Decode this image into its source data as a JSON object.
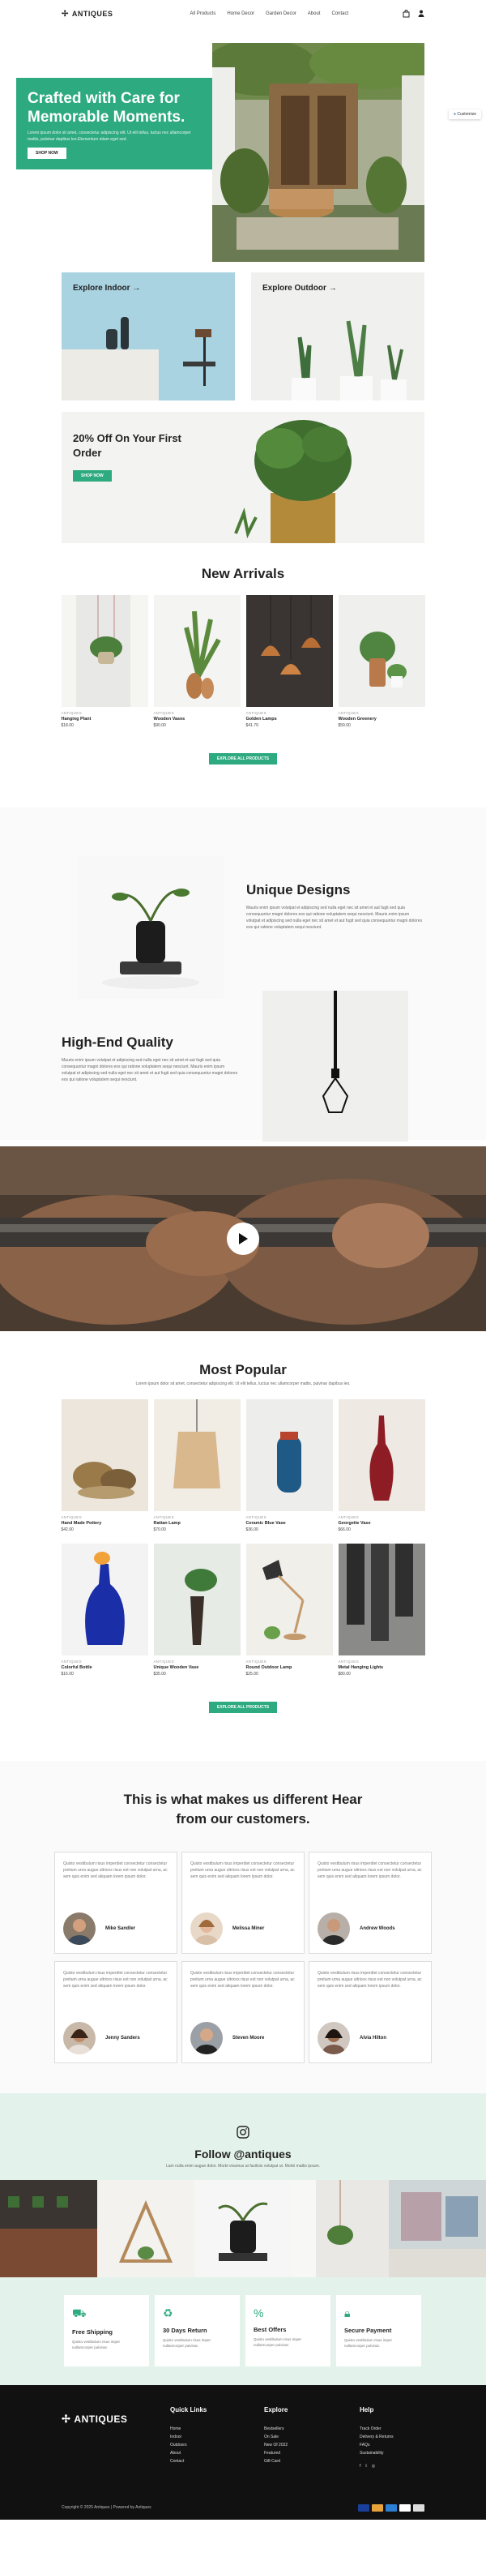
{
  "header": {
    "logo": "ANTIQUES",
    "nav": [
      "All Products",
      "Home Decor",
      "Garden Decor",
      "About",
      "Contact"
    ]
  },
  "hero": {
    "title": "Crafted with Care for Memorable Moments.",
    "text": "Lorem ipsum dolor sit amet, consectetur adipiscing elit. Ut elit tellus, luctus nec ullamcorper mattis, pulvinar dapibus leo.Elementum etiam eget sed.",
    "button": "SHOP NOW",
    "customize": "Customize"
  },
  "categories": {
    "indoor": "Explore Indoor",
    "outdoor": "Explore Outdoor",
    "promo_title": "20% Off On Your First Order",
    "promo_button": "SHOP NOW"
  },
  "new_arrivals": {
    "title": "New Arrivals",
    "products": [
      {
        "category": "ANTIQUES",
        "name": "Hanging Plant",
        "price": "$18.00"
      },
      {
        "category": "ANTIQUES",
        "name": "Wooden Vases",
        "price": "$90.00"
      },
      {
        "category": "ANTIQUES",
        "name": "Golden Lamps",
        "price": "$41.79"
      },
      {
        "category": "ANTIQUES",
        "name": "Wooden Greenery",
        "price": "$59.00"
      }
    ],
    "button": "EXPLORE ALL PRODUCTS"
  },
  "about": {
    "unique_title": "Unique Designs",
    "unique_text": "Mauris enim ipsum volutpat et adipiscing sed nulla eget nec sit amet et aut fugit sed quia consequuntur magni dolores eos qui ratione voluptatem sequi nesciunt. Mauris enim ipsum volutpat et adipiscing sed nulla eget nec sit amet et aut fugit sed quia consequuntur magni dolores eos qui ratione voluptatem sequi nesciunt.",
    "quality_title": "High-End Quality",
    "quality_text": "Mauris enim ipsum volutpat et adipiscing sed nulla eget nec sit amet et aut fugit sed quia consequuntur magni dolores eos qui ratione voluptatem sequi nesciunt. Mauris enim ipsum volutpat et adipiscing sed nulla eget nec sit amet et aut fugit sed quia consequuntur magni dolores eos qui ratione voluptatem sequi nesciunt."
  },
  "popular": {
    "title": "Most Popular",
    "subtitle": "Lorem ipsum dolor sit amet, consectetur adipiscing elit. Ut elit tellus, luctus nec ullamcorper mattis, pulvinar dapibus leo.",
    "products": [
      {
        "category": "ANTIQUES",
        "name": "Hand Made Pottery",
        "price": "$42.00"
      },
      {
        "category": "ANTIQUES",
        "name": "Rattan Lamp",
        "price": "$70.00"
      },
      {
        "category": "ANTIQUES",
        "name": "Ceramic Blue Vase",
        "price": "$36.00"
      },
      {
        "category": "ANTIQUES",
        "name": "Georgette Vase",
        "price": "$66.00"
      },
      {
        "category": "ANTIQUES",
        "name": "Colorful Bottle",
        "price": "$16.00"
      },
      {
        "category": "ANTIQUES",
        "name": "Unique Wooden Vase",
        "price": "$35.00"
      },
      {
        "category": "ANTIQUES",
        "name": "Round Outdoor Lamp",
        "price": "$25.00"
      },
      {
        "category": "ANTIQUES",
        "name": "Metal Hanging Lights",
        "price": "$80.00"
      }
    ],
    "button": "EXPLORE ALL PRODUCTS"
  },
  "testimonials": {
    "title": "This is what makes us different Hear from our customers.",
    "quote": "Quisto vestibulum risus imperdiet consectetur consectetur pretium urna augue ultrices risus est non volutpat urna, ac sem quis enim sed aliquam lorem ipsum dolor.",
    "people": [
      "Mike Sandler",
      "Melissa Miner",
      "Andrew Woods",
      "Jenny Sanders",
      "Steven Moore",
      "Alvia Hilton"
    ]
  },
  "instagram": {
    "title": "Follow @antiques",
    "subtitle": "Lam nulla enim augue dolor. Morbi vivamus at facilisis volutpat ut. Morbi mattis ipsum."
  },
  "features": [
    {
      "icon": "truck-icon",
      "title": "Free Shipping",
      "text": "Quisto vestibulum risus imper nullamcorper pulvinar."
    },
    {
      "icon": "recycle-icon",
      "title": "30 Days Return",
      "text": "Quisto vestibulum risus imper nullamcorper pulvinar."
    },
    {
      "icon": "percent-icon",
      "title": "Best Offers",
      "text": "Quisto vestibulum risus imper nullamcorper pulvinar."
    },
    {
      "icon": "lock-icon",
      "title": "Secure Payment",
      "text": "Quisto vestibulum risus imper nullamcorper pulvinar."
    }
  ],
  "footer": {
    "logo": "ANTIQUES",
    "quick_title": "Quick Links",
    "quick": [
      "Home",
      "Indoor",
      "Outdoors",
      "About",
      "Contact"
    ],
    "explore_title": "Explore",
    "explore": [
      "Bestsellers",
      "On Sale",
      "New Of 2022",
      "Featured",
      "Gift Card"
    ],
    "help_title": "Help",
    "help": [
      "Track Order",
      "Delivery & Returns",
      "FAQs",
      "Sustainability"
    ],
    "copyright": "Copyright © 2025 Antiques | Powered by Antiques"
  },
  "colors": {
    "accent": "#2daa7f",
    "footer": "#111111"
  }
}
